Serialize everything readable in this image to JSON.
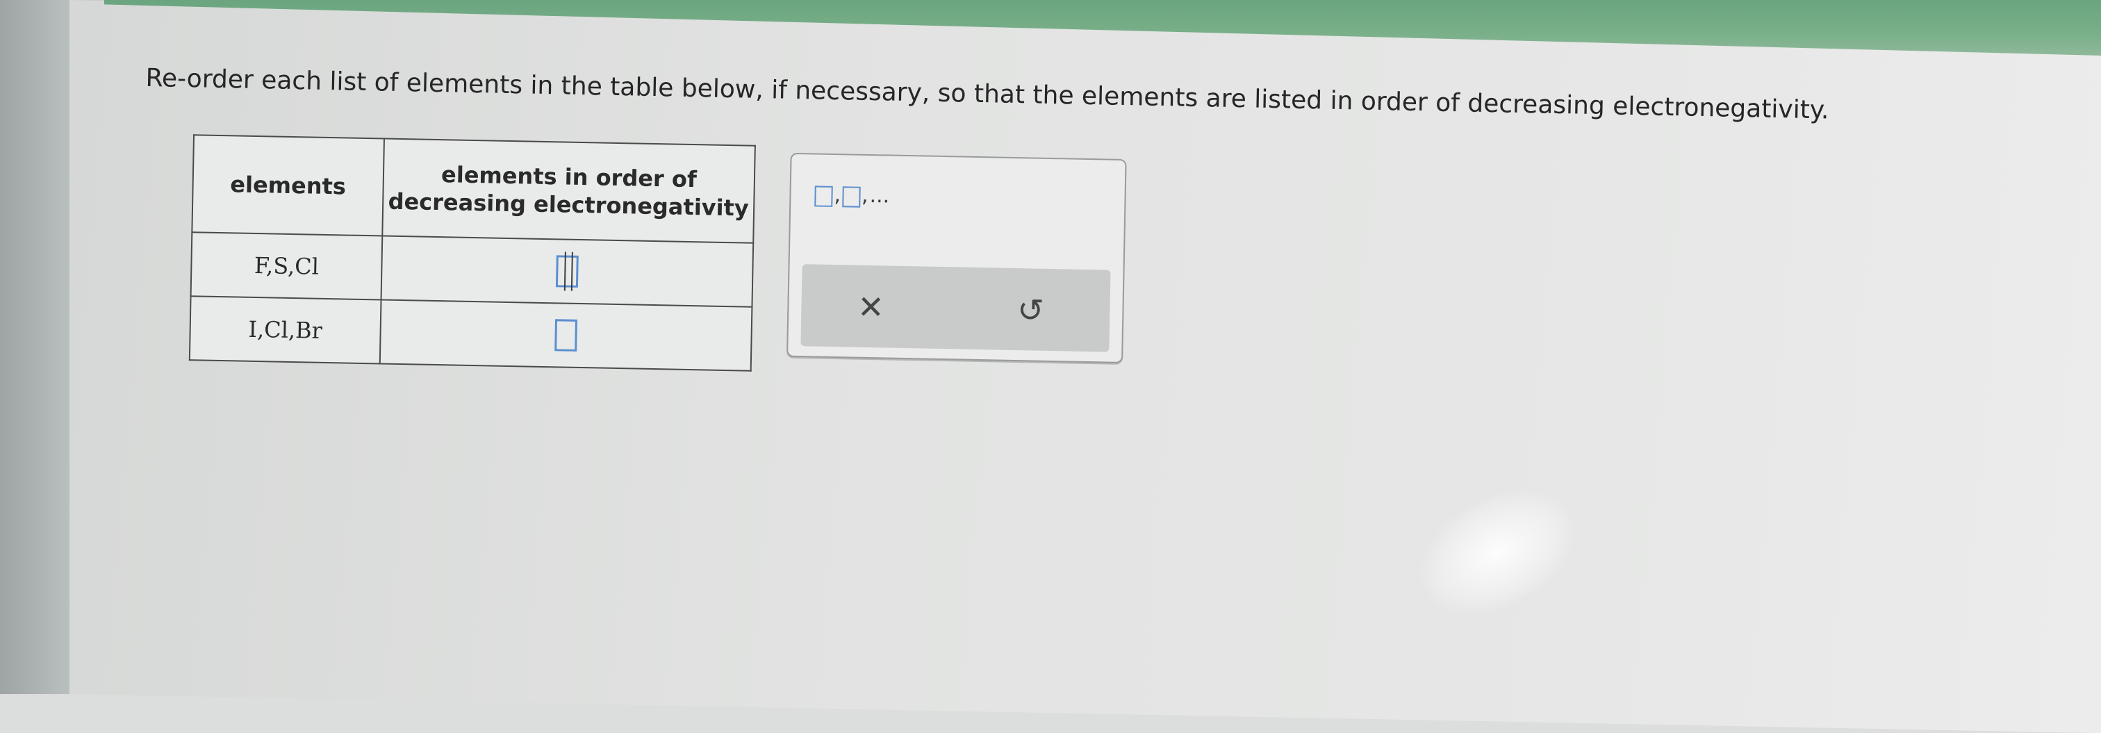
{
  "instruction": "Re-order each list of elements in the table below, if necessary, so that the elements are listed in order of decreasing electronegativity.",
  "table": {
    "headers": [
      "elements",
      "elements in order of decreasing electronegativity"
    ],
    "rows": [
      {
        "elements": "F,S,Cl",
        "answer": ""
      },
      {
        "elements": "I,Cl,Br",
        "answer": ""
      }
    ]
  },
  "palette": {
    "template_separator": ",",
    "template_ellipsis": "...",
    "clear_glyph": "✕",
    "undo_glyph": "↺"
  },
  "colors": {
    "input_box_border": "#5b8fd0",
    "top_band": "#6aa57f"
  },
  "icons": [
    "clear-x-icon",
    "undo-icon",
    "answer-box-icon"
  ]
}
